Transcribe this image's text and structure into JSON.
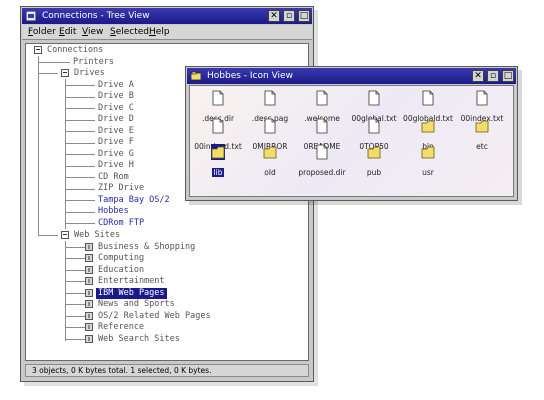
{
  "tree_window": {
    "title": "Connections - Tree View",
    "menu": [
      "Folder",
      "Edit",
      "View",
      "Selected",
      "Help"
    ],
    "status": "3 objects, 0 K bytes total.  1 selected, 0 K bytes.",
    "nodes": {
      "connections": "Connections",
      "printers": "Printers",
      "drives": "Drives",
      "drive_a": "Drive A",
      "drive_b": "Drive B",
      "drive_c": "Drive C",
      "drive_d": "Drive D",
      "drive_e": "Drive E",
      "drive_f": "Drive F",
      "drive_g": "Drive G",
      "drive_h": "Drive H",
      "cd_rom": "CD Rom",
      "zip_drive": "ZIP Drive",
      "tampa_bay": "Tampa Bay OS/2",
      "hobbes": "Hobbes",
      "cdrom_ftp": "CDRom FTP",
      "web_sites": "Web Sites",
      "business": "Business & Shopping",
      "computing": "Computing",
      "education": "Education",
      "entertainment": "Entertainment",
      "ibm_web": "IBM Web Pages",
      "news": "News and Sports",
      "os2_related": "OS/2 Related Web Pages",
      "reference": "Reference",
      "web_search": "Web Search Sites"
    }
  },
  "icon_window": {
    "title": "Hobbes - Icon View",
    "items": {
      "desc_dir": ".desc.dir",
      "desc_pag": ".desc.pag",
      "welcome": ".welcome",
      "global_txt": "00global.txt",
      "globald_txt": "00globald.txt",
      "index_txt": "00index.txt",
      "indexd_txt": "00indexd.txt",
      "mirror": "0MIRROR",
      "readme": "0README",
      "top50": "0TOP50",
      "bin": "bin",
      "etc": "etc",
      "lib": "lib",
      "old": "old",
      "proposed": "proposed.dir",
      "pub": "pub",
      "usr": "usr"
    }
  },
  "colors": {
    "titlebar": "#1a1a8a",
    "window_face": "#c9c9c9",
    "selection": "#1a1a8a",
    "folder_yellow": "#f2dc6a",
    "link_blue": "#2a2aa8"
  }
}
